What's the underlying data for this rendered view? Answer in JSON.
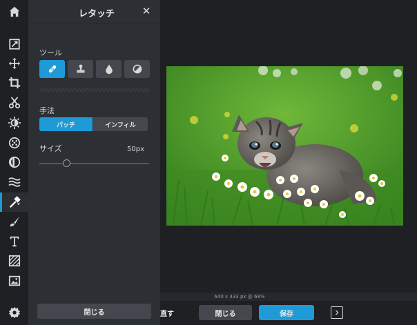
{
  "panel": {
    "title": "レタッチ",
    "close_symbol": "✕",
    "tools_label": "ツール",
    "method_label": "手法",
    "method_options": [
      "パッチ",
      "インフィル"
    ],
    "size_label": "サイズ",
    "size_value": "50px",
    "close_button": "閉じる"
  },
  "toolbar": {
    "items": [
      {
        "icon": "home-icon"
      },
      {
        "icon": "adjust-icon"
      },
      {
        "icon": "move-icon"
      },
      {
        "icon": "crop-icon"
      },
      {
        "icon": "cut-icon"
      },
      {
        "icon": "exposure-icon"
      },
      {
        "icon": "effects-icon"
      },
      {
        "icon": "vignette-icon"
      },
      {
        "icon": "wave-icon"
      },
      {
        "icon": "retouch-icon",
        "active": true
      },
      {
        "icon": "brush-icon"
      },
      {
        "icon": "text-icon"
      },
      {
        "icon": "texture-icon"
      },
      {
        "icon": "image-icon"
      },
      {
        "icon": "settings-icon"
      }
    ]
  },
  "status": {
    "text": "640 x 433 px @ 68%"
  },
  "bottom": {
    "redo_label": "直す",
    "close_label": "閉じる",
    "save_label": "保存"
  },
  "colors": {
    "accent": "#1e9bd7",
    "panel": "#2c2f34",
    "background": "#1e2024"
  }
}
